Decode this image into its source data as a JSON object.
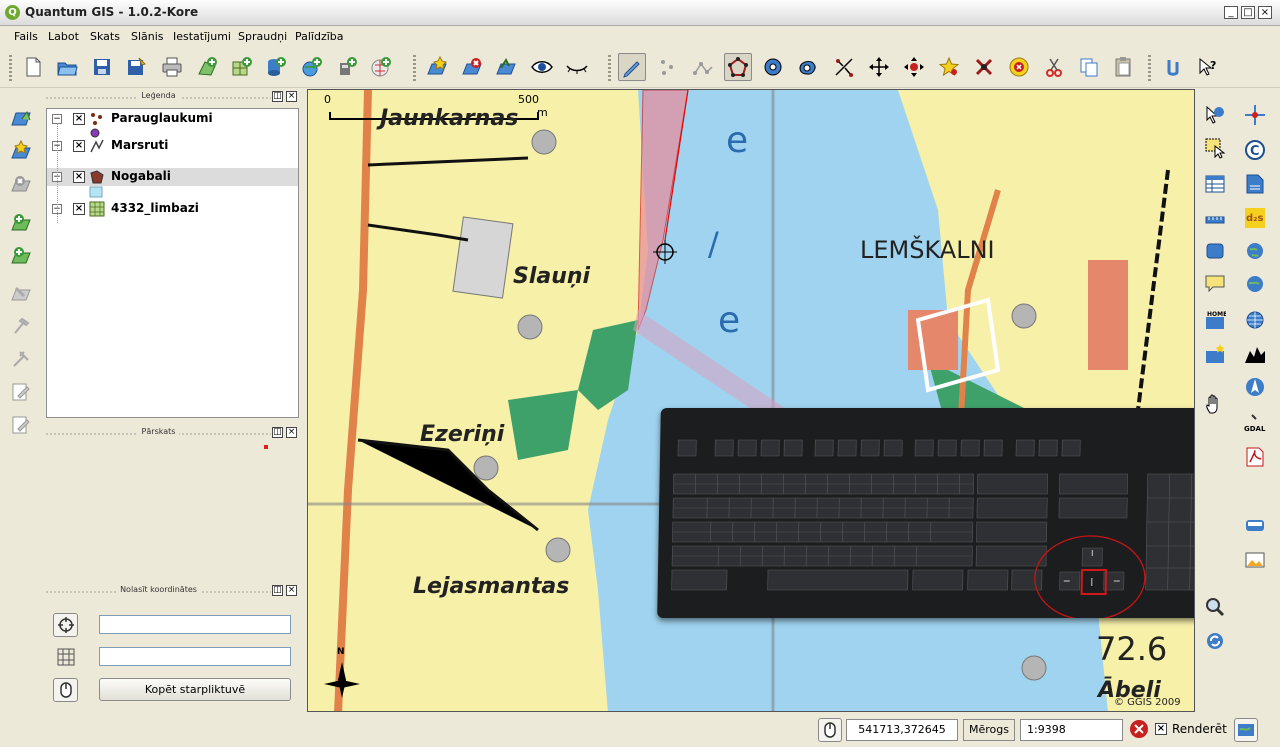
{
  "window": {
    "title": "Quantum GIS - 1.0.2-Kore",
    "app_icon": "Q",
    "minimize": "_",
    "maximize": "□",
    "close": "×"
  },
  "menu": [
    "Fails",
    "Labot",
    "Skats",
    "Slānis",
    "Iestatījumi",
    "Spraudņi",
    "Palīdzība"
  ],
  "toolbar_icons": [
    "new-project-icon",
    "open-project-icon",
    "save-project-icon",
    "save-as-icon",
    "print-icon",
    "add-vector-icon",
    "add-raster-icon",
    "add-postgis-icon",
    "add-wms-icon",
    "add-spatialite-icon",
    "add-wfs-icon",
    "new-layer-icon",
    "remove-layer-icon",
    "add-layer-icon",
    "show-all-icon",
    "hide-all-icon",
    "toggle-editing-icon",
    "capture-point-icon",
    "capture-line-icon",
    "capture-polygon-icon",
    "add-ring-icon",
    "add-island-icon",
    "split-features-icon",
    "move-feature-icon",
    "move-vertex-icon",
    "add-vertex-icon",
    "delete-vertex-icon",
    "delete-selected-icon",
    "cut-features-icon",
    "copy-features-icon",
    "paste-features-icon",
    "select-icon",
    "whats-this-icon"
  ],
  "panels": {
    "legend_title": "Leģenda",
    "overview_title": "Pārskats",
    "coords_title": "Nolasīt koordinātes",
    "float": "◫",
    "close": "×"
  },
  "legend": [
    {
      "name": "Parauglaukumi",
      "checked": "×",
      "toggle": "−",
      "selected": false
    },
    {
      "name": "Marsruti",
      "checked": "×",
      "toggle": "−",
      "selected": false
    },
    {
      "name": "Nogabali",
      "checked": "×",
      "toggle": "−",
      "selected": true
    },
    {
      "name": "4332_limbazi",
      "checked": "×",
      "toggle": "−",
      "selected": false
    }
  ],
  "coords": {
    "field1": "",
    "field2": "",
    "copy_button": "Kopēt starpliktuvē"
  },
  "map": {
    "scalebar": {
      "start": "0",
      "end": "500",
      "unit": "m"
    },
    "labels": [
      "Jaunkarnas",
      "Slauņi",
      "LEMŠKALNI",
      "Ezeriņi",
      "Lejasmantas",
      "72.6",
      "Ābeli"
    ],
    "river_letters": [
      "e",
      "/",
      "e"
    ],
    "north": "N",
    "copyright": "© GGIS 2009",
    "keyboard_image": "keyboard-down-arrow-highlighted"
  },
  "statusbar": {
    "coordinates": "541713,372645",
    "scale_label": "Mērogs",
    "scale_value": "1:9398",
    "render_label": "Renderēt",
    "render_checked": "×"
  },
  "colors": {
    "accent": "#316ac5",
    "window_bg": "#ece9d8",
    "map_yellow": "#f7f0a9",
    "river_blue": "#9fd3ef",
    "forest_green": "#3fa16a"
  }
}
